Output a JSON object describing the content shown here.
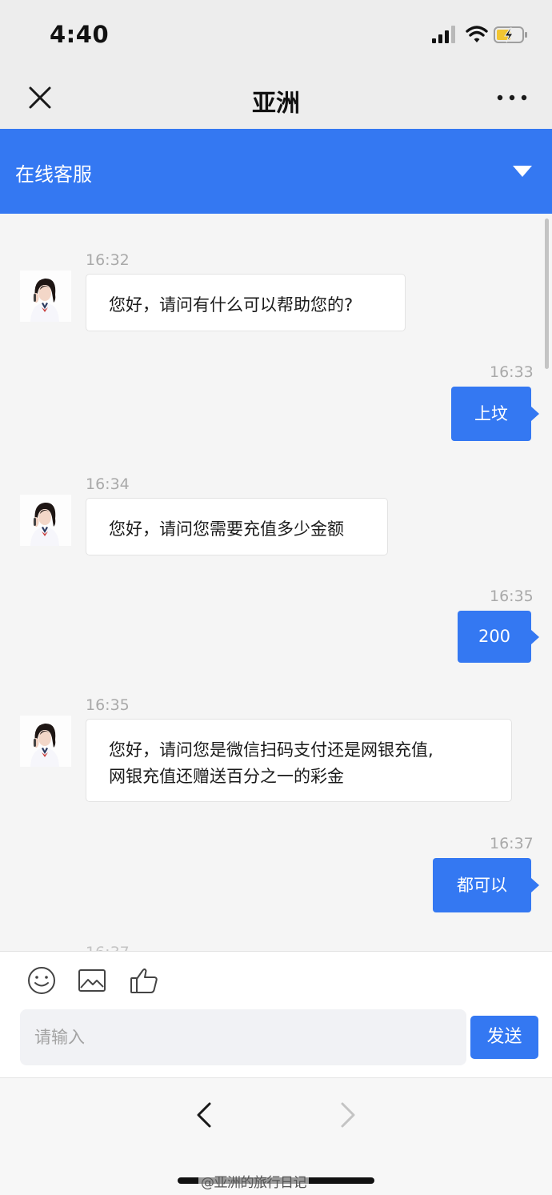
{
  "status_bar": {
    "time": "4:40",
    "icons": [
      "signal-icon",
      "wifi-icon",
      "battery-charging-icon"
    ]
  },
  "nav": {
    "title": "亚洲",
    "close_icon": "close-icon",
    "more_icon": "more-icon"
  },
  "service_bar": {
    "label": "在线客服",
    "toggle_icon": "caret-down-icon"
  },
  "messages": [
    {
      "side": "in",
      "time": "16:32",
      "lines": [
        "您好，请问有什么可以帮助您的?"
      ]
    },
    {
      "side": "out",
      "time": "16:33",
      "lines": [
        "上坟"
      ]
    },
    {
      "side": "in",
      "time": "16:34",
      "lines": [
        "您好，请问您需要充值多少金额"
      ]
    },
    {
      "side": "out",
      "time": "16:35",
      "lines": [
        "200"
      ]
    },
    {
      "side": "in",
      "time": "16:35",
      "lines": [
        "您好，请问您是微信扫码支付还是网银充值,",
        "网银充值还赠送百分之一的彩金"
      ]
    },
    {
      "side": "out",
      "time": "16:37",
      "lines": [
        "都可以"
      ]
    }
  ],
  "composer": {
    "icons": [
      "emoji-icon",
      "image-icon",
      "thumbs-up-icon"
    ],
    "placeholder": "请输入",
    "send_label": "发送"
  },
  "bottom_nav": {
    "back_icon": "back-icon",
    "forward_icon": "forward-icon"
  },
  "watermark": "@亚洲的旅行日记"
}
